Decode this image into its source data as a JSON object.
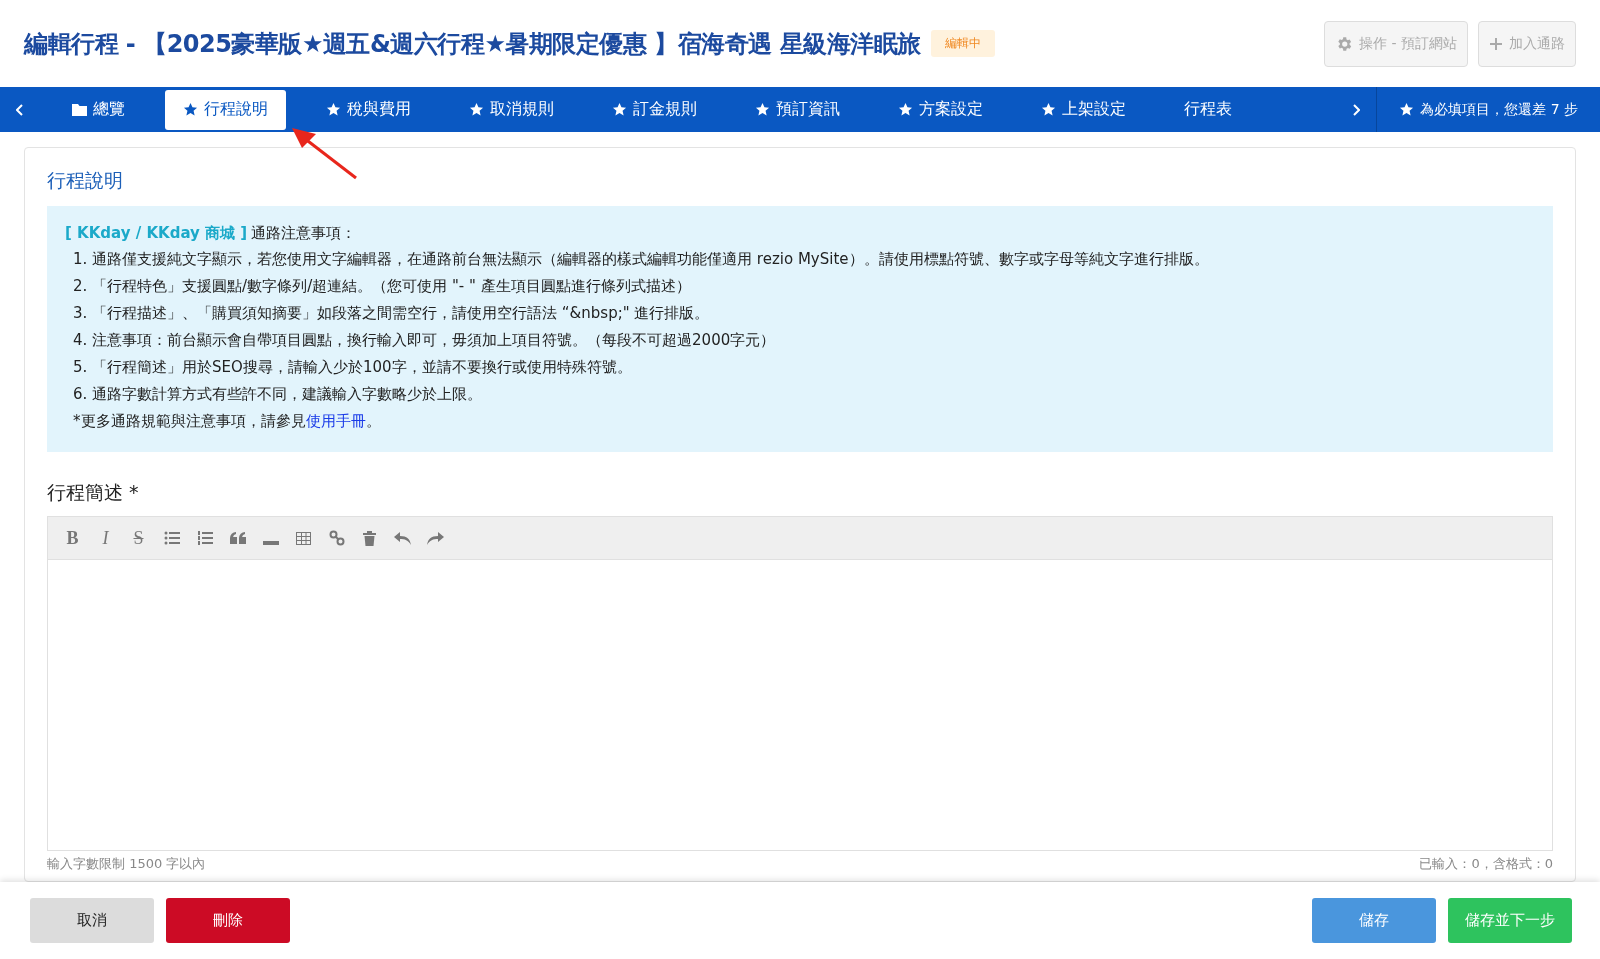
{
  "header": {
    "title": "編輯行程 - 【2025豪華版★週五&週六行程★暑期限定優惠 】宿海奇遇 星級海洋眠旅",
    "status_badge": "編輯中",
    "buttons": [
      {
        "label": "操作 - 預訂網站",
        "kind": "gear",
        "disabled": true
      },
      {
        "label": "加入通路",
        "kind": "plus",
        "disabled": true
      }
    ]
  },
  "tabs": [
    {
      "label": "總覽",
      "kind": "folder",
      "required": false,
      "selected": false
    },
    {
      "label": "行程說明",
      "kind": "text",
      "required": true,
      "selected": true
    },
    {
      "label": "稅與費用",
      "kind": "text",
      "required": true,
      "selected": false
    },
    {
      "label": "取消規則",
      "kind": "text",
      "required": true,
      "selected": false
    },
    {
      "label": "訂金規則",
      "kind": "text",
      "required": true,
      "selected": false
    },
    {
      "label": "預訂資訊",
      "kind": "text",
      "required": true,
      "selected": false
    },
    {
      "label": "方案設定",
      "kind": "text",
      "required": true,
      "selected": false
    },
    {
      "label": "上架設定",
      "kind": "text",
      "required": true,
      "selected": false
    },
    {
      "label": "行程表",
      "kind": "text",
      "required": false,
      "selected": false
    }
  ],
  "required_note": "為必填項目，您還差 7 步",
  "section_title": "行程說明",
  "notice": {
    "channel": "[ KKday / KKday 商城 ]",
    "heading": "通路注意事項：",
    "items": [
      "1. 通路僅支援純文字顯示，若您使用文字編輯器，在通路前台無法顯示（編輯器的樣式編輯功能僅適用 rezio MySite）。請使用標點符號、數字或字母等純文字進行排版。",
      "2. 「行程特色」支援圓點/數字條列/超連結。（您可使用 \"- \" 產生項目圓點進行條列式描述）",
      "3. 「行程描述」、「購買須知摘要」如段落之間需空行，請使用空行語法 “&nbsp;\" 進行排版。",
      "4. 注意事項：前台顯示會自帶項目圓點，換行輸入即可，毋須加上項目符號。（每段不可超過2000字元）",
      "5. 「行程簡述」用於SEO搜尋，請輸入少於100字，並請不要換行或使用特殊符號。",
      "6. 通路字數計算方式有些許不同，建議輸入字數略少於上限。"
    ],
    "footer_text": "*更多通路規範與注意事項，請參見",
    "footer_link": "使用手冊",
    "footer_end": "。"
  },
  "field": {
    "label": "行程簡述 *",
    "toolbar": [
      {
        "kind": "bold",
        "label": "B"
      },
      {
        "kind": "italic",
        "label": "I"
      },
      {
        "kind": "strike",
        "label": "S"
      },
      {
        "kind": "bullet-list"
      },
      {
        "kind": "numbered-list"
      },
      {
        "kind": "quote"
      },
      {
        "kind": "rule"
      },
      {
        "kind": "table"
      },
      {
        "kind": "link"
      },
      {
        "kind": "trash"
      },
      {
        "kind": "undo"
      },
      {
        "kind": "redo"
      }
    ],
    "limit": "輸入字數限制 1500 字以內",
    "count": "已輸入：0，含格式：0"
  },
  "footer": {
    "buttons": [
      {
        "label": "取消",
        "kind": "cancel"
      },
      {
        "label": "刪除",
        "kind": "delete"
      },
      {
        "label": "儲存",
        "kind": "save"
      },
      {
        "label": "儲存並下一步",
        "kind": "next"
      }
    ]
  }
}
